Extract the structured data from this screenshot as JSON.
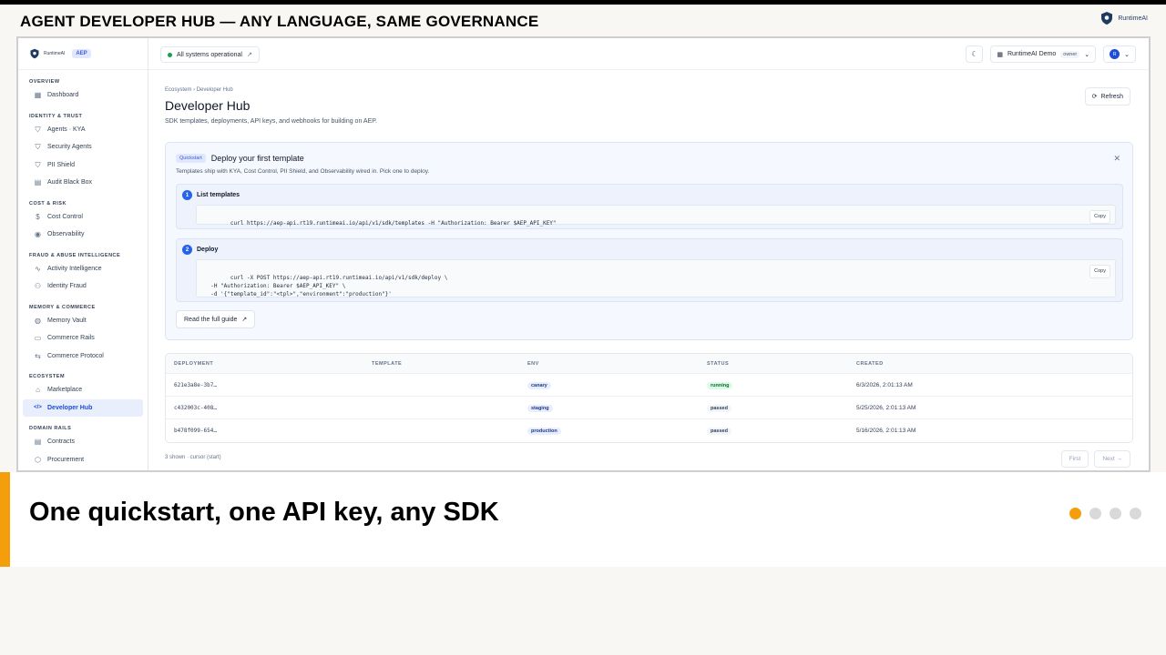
{
  "slide": {
    "title": "AGENT DEVELOPER HUB — ANY LANGUAGE, SAME GOVERNANCE",
    "brand": "RuntimeAI",
    "caption": "One quickstart, one API key, any SDK",
    "accent_color": "#f59e0b",
    "pagination": {
      "total": 4,
      "current": 1
    }
  },
  "sidebar": {
    "brand": "RuntimeAI",
    "badge": "AEP",
    "sections": [
      {
        "title": "OVERVIEW",
        "items": [
          {
            "label": "Dashboard",
            "icon": "grid-icon"
          }
        ]
      },
      {
        "title": "IDENTITY & TRUST",
        "items": [
          {
            "label": "Agents · KYA",
            "icon": "shield-check-icon"
          },
          {
            "label": "Security Agents",
            "icon": "shield-icon"
          },
          {
            "label": "PII Shield",
            "icon": "shield-icon"
          },
          {
            "label": "Audit Black Box",
            "icon": "file-icon"
          }
        ]
      },
      {
        "title": "COST & RISK",
        "items": [
          {
            "label": "Cost Control",
            "icon": "dollar-icon"
          },
          {
            "label": "Observability",
            "icon": "eye-icon"
          }
        ]
      },
      {
        "title": "FRAUD & ABUSE INTELLIGENCE",
        "items": [
          {
            "label": "Activity Intelligence",
            "icon": "activity-icon"
          },
          {
            "label": "Identity Fraud",
            "icon": "user-x-icon"
          }
        ]
      },
      {
        "title": "MEMORY & COMMERCE",
        "items": [
          {
            "label": "Memory Vault",
            "icon": "globe-icon"
          },
          {
            "label": "Commerce Rails",
            "icon": "card-icon"
          },
          {
            "label": "Commerce Protocol",
            "icon": "swap-icon"
          }
        ]
      },
      {
        "title": "ECOSYSTEM",
        "items": [
          {
            "label": "Marketplace",
            "icon": "store-icon"
          },
          {
            "label": "Developer Hub",
            "icon": "code-icon",
            "active": true
          }
        ]
      },
      {
        "title": "DOMAIN RAILS",
        "items": [
          {
            "label": "Contracts",
            "icon": "file-icon"
          },
          {
            "label": "Procurement",
            "icon": "box-icon"
          }
        ]
      }
    ]
  },
  "header": {
    "status": "All systems operational",
    "org": "RuntimeAI Demo",
    "role": "owner",
    "avatar": "R"
  },
  "main": {
    "breadcrumb_root": "Ecosystem",
    "breadcrumb_sep": "›",
    "breadcrumb_current": "Developer Hub",
    "title": "Developer Hub",
    "subtitle": "SDK templates, deployments, API keys, and webhooks for building on AEP.",
    "refresh_label": "Refresh"
  },
  "quickstart": {
    "badge": "Quickstart",
    "title": "Deploy your first template",
    "description": "Templates ship with KYA, Cost Control, PII Shield, and Observability wired in. Pick one to deploy.",
    "steps": [
      {
        "num": "1",
        "title": "List templates",
        "code": "curl https://aep-api.rt19.runtimeai.io/api/v1/sdk/templates -H \"Authorization: Bearer $AEP_API_KEY\"",
        "copy": "Copy"
      },
      {
        "num": "2",
        "title": "Deploy",
        "code": "curl -X POST https://aep-api.rt19.runtimeai.io/api/v1/sdk/deploy \\\n  -H \"Authorization: Bearer $AEP_API_KEY\" \\\n  -d '{\"template_id\":\"<tpl>\",\"environment\":\"production\"}'",
        "copy": "Copy"
      }
    ],
    "guide_label": "Read the full guide"
  },
  "deployments": {
    "columns": [
      "DEPLOYMENT",
      "TEMPLATE",
      "ENV",
      "STATUS",
      "CREATED"
    ],
    "rows": [
      {
        "id": "621e3a8e-3b7…",
        "template": "",
        "env": "canary",
        "status": "running",
        "created": "6/3/2026, 2:01:13 AM"
      },
      {
        "id": "c432003c-408…",
        "template": "",
        "env": "staging",
        "status": "passed",
        "created": "5/25/2026, 2:01:13 AM"
      },
      {
        "id": "b478f099-654…",
        "template": "",
        "env": "production",
        "status": "passed",
        "created": "5/16/2026, 2:01:13 AM"
      }
    ],
    "footer": "3 shown · cursor (start)",
    "first_label": "First",
    "next_label": "Next →"
  }
}
